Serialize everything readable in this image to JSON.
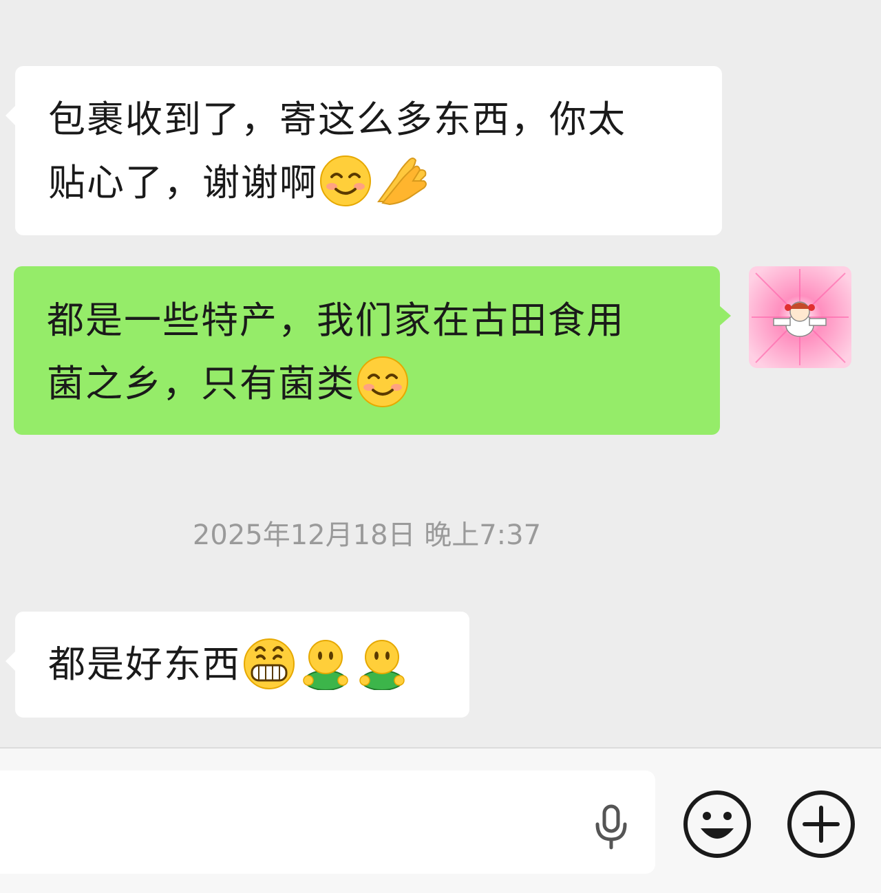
{
  "messages": [
    {
      "side": "incoming",
      "lines": [
        {
          "text": "包裹收到了，寄这么多东西，你太",
          "emojis": []
        },
        {
          "text": "贴心了，谢谢啊",
          "emojis": [
            "smiling-blush-emoji",
            "hand-clap-emoji"
          ]
        }
      ]
    },
    {
      "side": "outgoing",
      "lines": [
        {
          "text": "都是一些特产，我们家在古田食用",
          "emojis": []
        },
        {
          "text": "菌之乡，只有菌类",
          "emojis": [
            "smiling-blush-emoji"
          ]
        }
      ]
    },
    {
      "side": "incoming",
      "lines": [
        {
          "text": "都是好东西",
          "emojis": [
            "grin-emoji",
            "green-person-emoji",
            "green-person-emoji"
          ]
        }
      ]
    }
  ],
  "timestamp": "2025年12月18日 晚上7:37",
  "input": {
    "placeholder": "",
    "voice_icon": "microphone-icon",
    "emoji_icon": "smiley-face-icon",
    "more_icon": "plus-icon"
  },
  "colors": {
    "background": "#ededed",
    "incoming_bubble": "#ffffff",
    "outgoing_bubble": "#95ec69",
    "timestamp_text": "#9a9a9a"
  }
}
